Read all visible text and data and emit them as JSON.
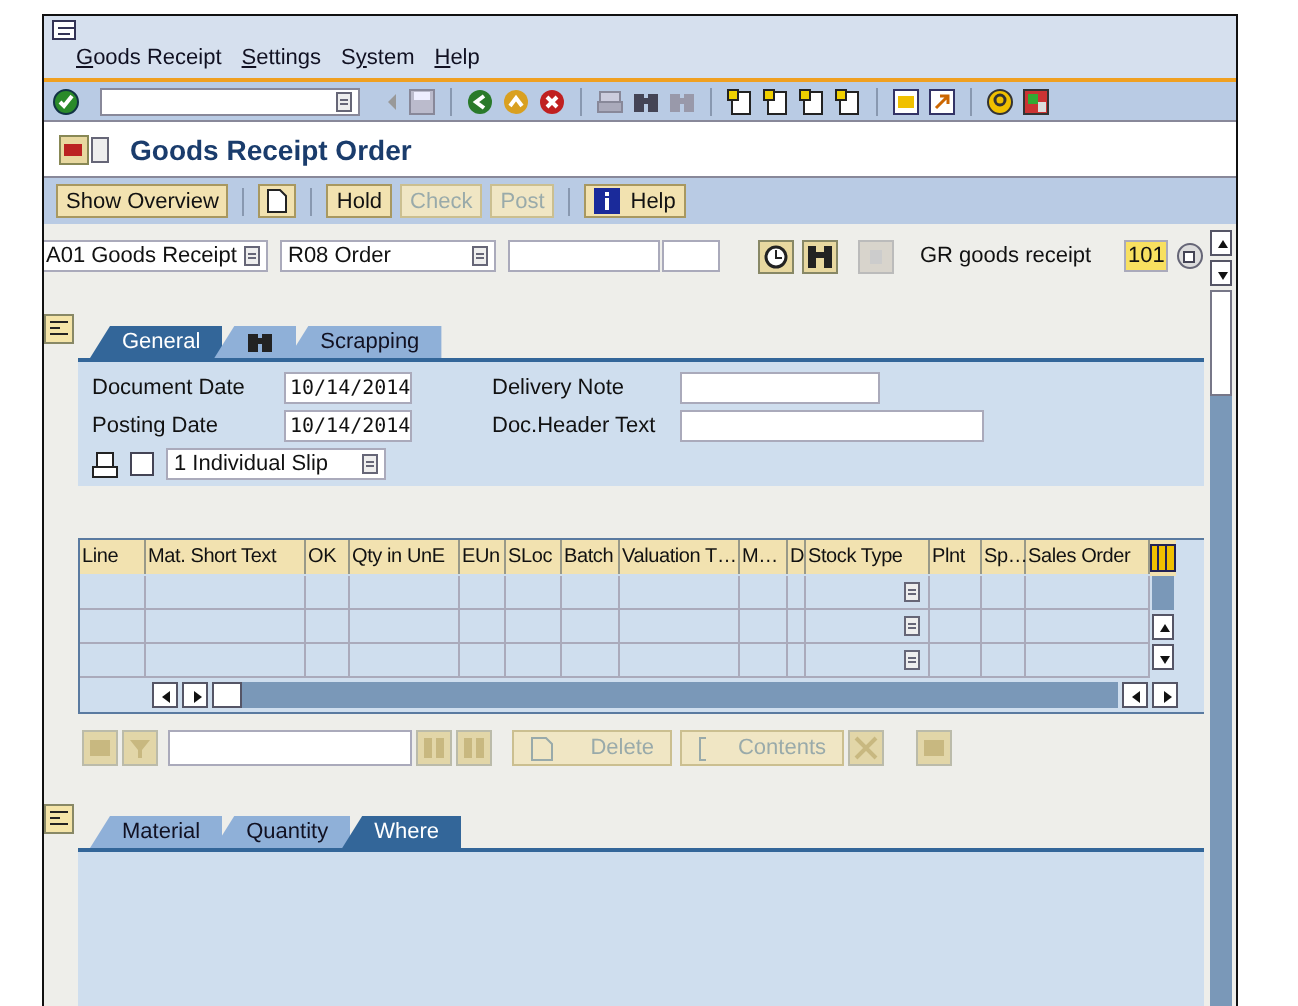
{
  "menu": [
    {
      "mnemonic": "G",
      "after": "oods Receipt"
    },
    {
      "mnemonic": "S",
      "after": "ettings"
    },
    {
      "before": "S",
      "mnemonic": "y",
      "after": "stem"
    },
    {
      "mnemonic": "H",
      "after": "elp"
    }
  ],
  "title": "Goods Receipt Order",
  "app_toolbar": [
    {
      "kind": "text",
      "label": "Show Overview",
      "disabled": false
    },
    {
      "kind": "icon",
      "disabled": false
    },
    {
      "kind": "text",
      "label": "Hold",
      "disabled": false
    },
    {
      "kind": "text",
      "label": "Check",
      "disabled": true
    },
    {
      "kind": "text",
      "label": "Post",
      "disabled": true
    },
    {
      "kind": "info",
      "label": "Help",
      "disabled": false
    }
  ],
  "selection": {
    "action": "A01 Goods Receipt",
    "reference": "R08 Order",
    "description": "GR goods receipt",
    "movement_type": "101"
  },
  "header_tabs": [
    {
      "label": "General",
      "kind": "text",
      "selected": true
    },
    {
      "kind": "icon",
      "selected": false
    },
    {
      "label": "Scrapping",
      "kind": "text",
      "selected": false
    }
  ],
  "header": {
    "document_date_label": "Document Date",
    "document_date": "10/14/2014",
    "posting_date_label": "Posting Date",
    "posting_date": "10/14/2014",
    "print_checked": false,
    "slip": "1 Individual Slip",
    "delivery_note_label": "Delivery Note",
    "doc_header_text_label": "Doc.Header Text"
  },
  "table": {
    "columns": [
      "Line",
      "Mat. Short Text",
      "OK",
      "Qty in UnE",
      "EUn",
      "SLoc",
      "Batch",
      "Valuation T…",
      "M…",
      "D",
      "Stock Type",
      "Plnt",
      "Sp…",
      "Sales Order"
    ]
  },
  "item_buttons": [
    {
      "label": "Delete",
      "disabled": true
    },
    {
      "label": "Contents",
      "disabled": true
    }
  ],
  "detail_tabs": [
    {
      "label": "Material",
      "selected": false
    },
    {
      "label": "Quantity",
      "selected": false
    },
    {
      "label": "Where",
      "selected": true
    }
  ]
}
